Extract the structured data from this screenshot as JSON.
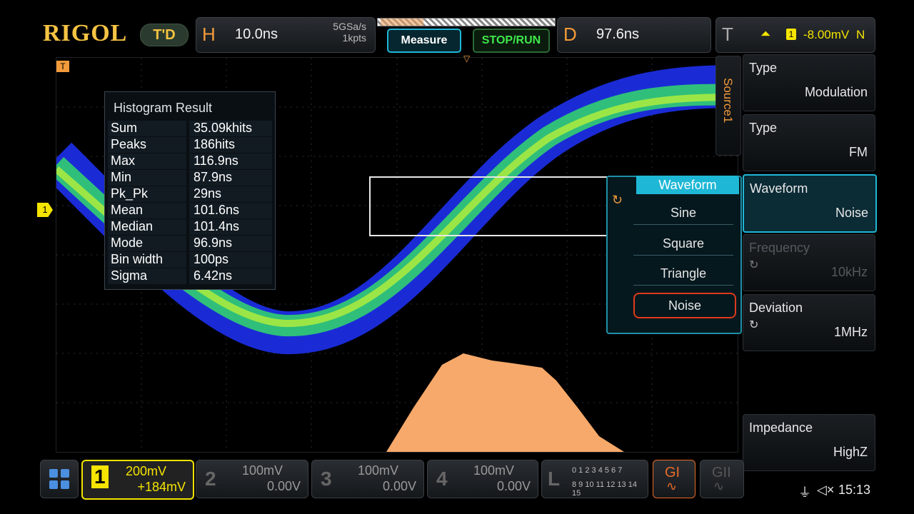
{
  "brand": {
    "logo": "RIGOL",
    "mode": "T'D"
  },
  "top": {
    "h_letter": "H",
    "h_value": "10.0ns",
    "h_rate": "5GSa/s",
    "h_pts": "1kpts",
    "measure_label": "Measure",
    "stoprun_label": "STOP/RUN",
    "d_letter": "D",
    "d_value": "97.6ns",
    "t_letter": "T",
    "t_channel": "1",
    "t_value": "-8.00mV",
    "t_mode": "N"
  },
  "histogram": {
    "title": "Histogram Result",
    "rows": [
      {
        "k": "Sum",
        "v": "35.09khits"
      },
      {
        "k": "Peaks",
        "v": "186hits"
      },
      {
        "k": "Max",
        "v": "116.9ns"
      },
      {
        "k": "Min",
        "v": "87.9ns"
      },
      {
        "k": "Pk_Pk",
        "v": "29ns"
      },
      {
        "k": "Mean",
        "v": "101.6ns"
      },
      {
        "k": "Median",
        "v": "101.4ns"
      },
      {
        "k": "Mode",
        "v": "96.9ns"
      },
      {
        "k": "Bin width",
        "v": "100ps"
      },
      {
        "k": "Sigma",
        "v": "6.42ns"
      }
    ]
  },
  "ch1_marker": "1",
  "popup": {
    "title": "Waveform",
    "items": [
      "Sine",
      "Square",
      "Triangle",
      "Noise"
    ],
    "selected": "Noise"
  },
  "menu": {
    "source_tab": "Source1",
    "items": [
      {
        "label": "Type",
        "value": "Modulation"
      },
      {
        "label": "Type",
        "value": "FM"
      },
      {
        "label": "Waveform",
        "value": "Noise"
      },
      {
        "label": "Frequency",
        "value": "10kHz"
      },
      {
        "label": "Deviation",
        "value": "1MHz"
      },
      {
        "label": "Impedance",
        "value": "HighZ"
      }
    ]
  },
  "channels": [
    {
      "num": "1",
      "scale": "200mV",
      "offset": "+184mV",
      "color": "#f5e400"
    },
    {
      "num": "2",
      "scale": "100mV",
      "offset": "0.00V",
      "color": "#777"
    },
    {
      "num": "3",
      "scale": "100mV",
      "offset": "0.00V",
      "color": "#777"
    },
    {
      "num": "4",
      "scale": "100mV",
      "offset": "0.00V",
      "color": "#777"
    }
  ],
  "logic": {
    "letter": "L",
    "row1": "0 1 2 3  4 5 6 7",
    "row2": "8 9 10 11 12 13 14 15"
  },
  "gen": {
    "g1": "GI",
    "g2": "GII"
  },
  "status": {
    "time": "15:13"
  },
  "colors": {
    "accent": "#1fb7d6",
    "orange": "#f39b3a",
    "ch1": "#f5e400",
    "alert": "#e03a1c"
  }
}
